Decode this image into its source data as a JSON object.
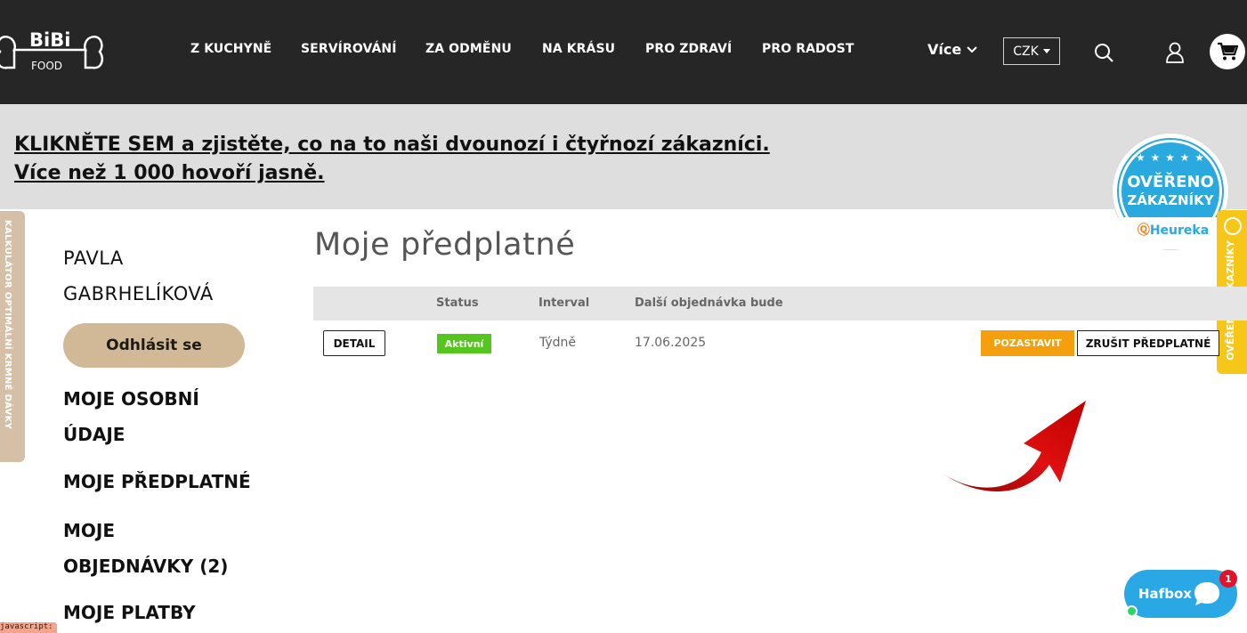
{
  "header": {
    "logo_top": "BiBi",
    "logo_bottom": "FOOD",
    "nav": [
      {
        "label": "Z KUCHYNĚ"
      },
      {
        "label": "SERVÍROVÁNÍ"
      },
      {
        "label": "ZA ODMĚNU"
      },
      {
        "label": "NA KRÁSU"
      },
      {
        "label": "PRO ZDRAVÍ"
      },
      {
        "label": "PRO RADOST"
      }
    ],
    "more_label": "Více",
    "currency": "CZK",
    "icons": [
      "search-icon",
      "user-icon",
      "cart-icon"
    ]
  },
  "banner": {
    "line1": "KLIKNĚTE SEM a zjistěte, co na to naši dvounozí i čtyřnozí zákazníci.",
    "line2": "Více než 1 000 hovoří jasně."
  },
  "heureka_badge": {
    "stars": "★ ★ ★ ★ ★",
    "line1": "OVĚŘENO",
    "line2": "ZÁKAZNÍKY",
    "brand": "Heureka"
  },
  "side_tabs": {
    "left": "KALKULÁTOR OPTIMÁLNÍ KRMNÉ DÁVKY",
    "right": "OVĚŘENO ZÁKAZNÍKY"
  },
  "account": {
    "name_line1": "PAVLA",
    "name_line2": "GABRHELÍKOVÁ",
    "logout": "Odhlásit se",
    "menu": [
      {
        "line1": "MOJE OSOBNÍ",
        "line2": "ÚDAJE"
      },
      {
        "line1": "MOJE PŘEDPLATNÉ",
        "line2": ""
      },
      {
        "line1": "MOJE",
        "line2": "OBJEDNÁVKY (2)"
      },
      {
        "line1": "MOJE PLATBY",
        "line2": ""
      }
    ]
  },
  "main": {
    "title": "Moje předplatné",
    "columns": [
      "Status",
      "Interval",
      "Další objednávka bude"
    ],
    "row": {
      "detail": "DETAIL",
      "status": "Aktivní",
      "interval": "Týdně",
      "next_order": "17.06.2025",
      "pause": "POZASTAVIT",
      "cancel": "ZRUŠIT PŘEDPLATNÉ"
    }
  },
  "chat": {
    "label": "Hafbox",
    "count": "1"
  },
  "status_bar": "javascript:",
  "colors": {
    "header_bg": "#262626",
    "banner_bg": "#dedede",
    "logout_btn": "#d1b896",
    "status_active": "#55c61e",
    "pause_btn": "#f49f0e",
    "chat_bg": "#2aa8e6",
    "arrow": "#d10000"
  }
}
